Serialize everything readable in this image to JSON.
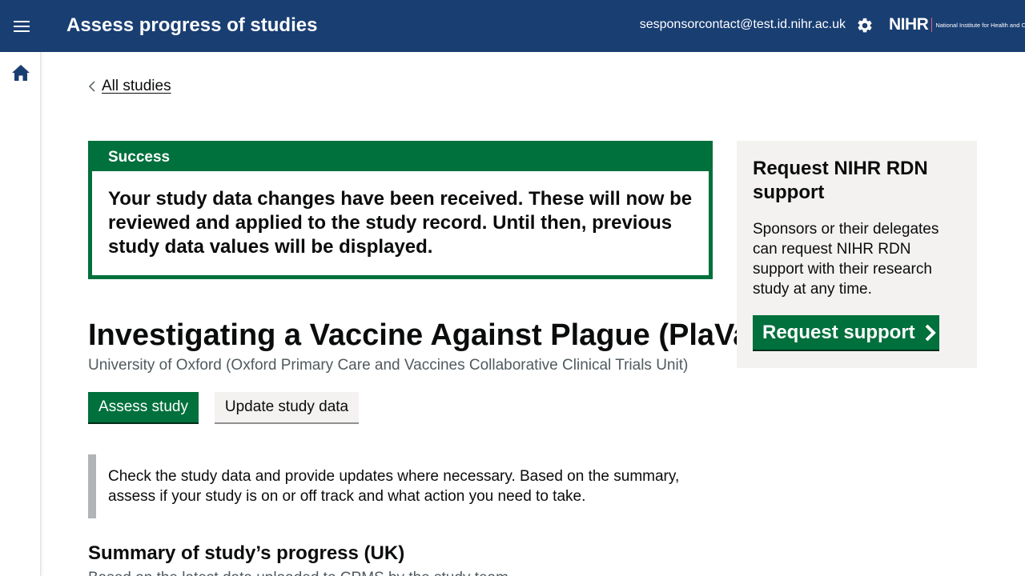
{
  "header": {
    "title": "Assess progress of studies",
    "user_email": "sesponsorcontact@test.id.nihr.ac.uk",
    "logo_main": "NIHR",
    "logo_sub": "National Institute for Health and Care Research",
    "icons": [
      "menu-icon",
      "gear-icon"
    ]
  },
  "sidebar": {
    "home_icon": "home-icon"
  },
  "breadcrumb": {
    "back_label": "All studies",
    "icon": "chevron-left-icon"
  },
  "banner": {
    "title": "Success",
    "message": "Your study data changes have been received. These will now be reviewed and applied to the study record. Until then, previous study data values will be displayed."
  },
  "study": {
    "title": "Investigating a Vaccine Against Plague (PlaVac)",
    "organisation": "University of Oxford (Oxford Primary Care and Vaccines Collaborative Clinical Trials Unit)"
  },
  "tabs": [
    {
      "label": "Assess study",
      "active": true
    },
    {
      "label": "Update study data",
      "active": false
    }
  ],
  "inset": {
    "text": "Check the study data and provide updates where necessary. Based on the summary, assess if your study is on or off track and what action you need to take."
  },
  "summary": {
    "title": "Summary of study’s progress (UK)",
    "subtitle": "Based on the latest data uploaded to CPMS by the study team."
  },
  "support": {
    "title": "Request NIHR RDN support",
    "text": "Sponsors or their delegates can request NIHR RDN support with their research study at any time.",
    "button_label": "Request support",
    "button_icon": "chevron-right-icon"
  },
  "colors": {
    "header_bg": "#193e72",
    "success_green": "#00703c",
    "panel_bg": "#f3f2f1",
    "inset_border": "#b1b4b6",
    "secondary_text": "#505a5f"
  }
}
